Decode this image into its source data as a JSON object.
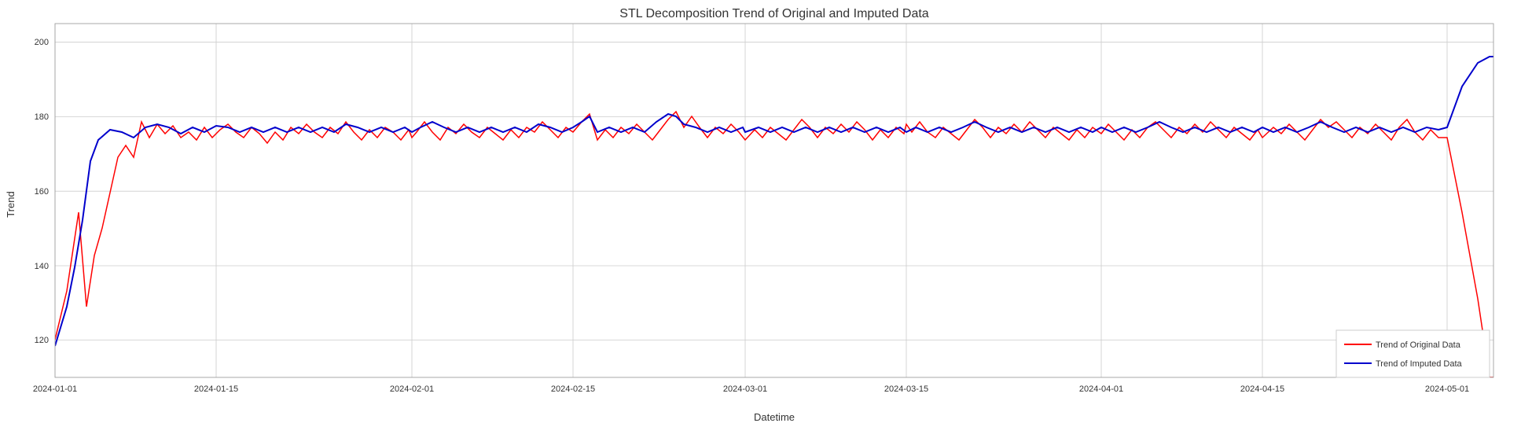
{
  "chart": {
    "title": "STL Decomposition Trend of Original and Imputed Data",
    "x_axis_label": "Datetime",
    "y_axis_label": "Trend",
    "x_ticks": [
      "2024-01-01",
      "2024-01-15",
      "2024-02-01",
      "2024-02-15",
      "2024-03-01",
      "2024-03-15",
      "2024-04-01",
      "2024-04-15",
      "2024-05-01"
    ],
    "y_ticks": [
      "120",
      "140",
      "160",
      "180",
      "200"
    ],
    "y_min": 110,
    "y_max": 205,
    "legend": {
      "original": "Trend of Original Data",
      "imputed": "Trend of Imputed Data"
    },
    "colors": {
      "original": "#ff0000",
      "imputed": "#0000cc"
    }
  }
}
